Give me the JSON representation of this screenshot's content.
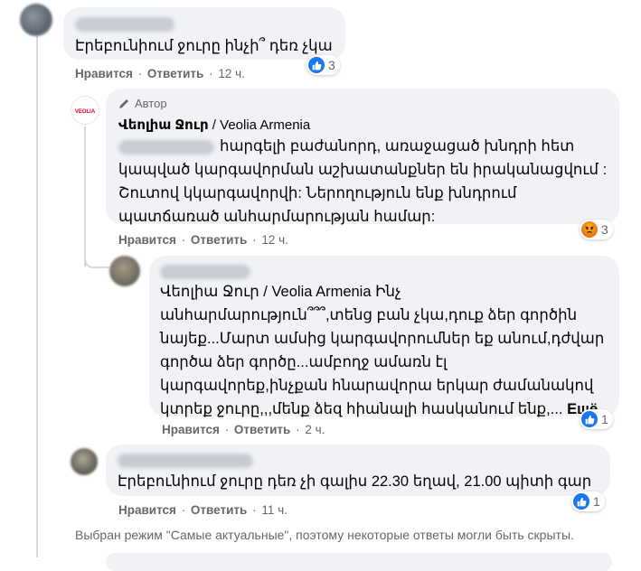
{
  "comments": [
    {
      "text": "Էրեբունիում ջուրը ինչի՞ դեռ չկա",
      "actions": {
        "like": "Нравится",
        "reply": "Ответить",
        "time": "12 ч."
      },
      "reaction_count": "3"
    },
    {
      "badge": "Автор",
      "author": "Վեոլիա Ջուր",
      "author_page": " / Veolia Armenia",
      "lines": [
        "հարգելի բաժանորդ, առաջացած խնդրի հետ",
        "կապված կարգավորման աշխատանքներ են իրականացվում :",
        "Շուտով կկարգավորվի: Ներողություն ենք խնդրում",
        "պատճառած անհարմարության համար:"
      ],
      "actions": {
        "like": "Нравится",
        "reply": "Ответить",
        "time": "12 ч."
      },
      "reaction_count": "3"
    },
    {
      "mention": "Վեոլիա Ջուր / Veolia Armenia",
      "lines": [
        " Ինչ",
        "անհարմարություն՞՞՞,տենց բան չկա,դուք ձեր գործին",
        "նայեք...Մարտ ամսից կարգավորումներ եք անում,դժվար",
        "գործա ձեր գործը...ամբողջ ամառն էլ",
        "կարգավորեք,ինչքան հնարավորա երկար ժամանակով",
        "կտրեք ջուրը,,,մենք ձեզ հիանալի հասկանում ենք,... "
      ],
      "see_more": "Ещё",
      "actions": {
        "like": "Нравится",
        "reply": "Ответить",
        "time": "2 ч."
      },
      "reaction_count": "1"
    },
    {
      "text": "Էրեբունիում ջուրը դեռ չի գալիս 22.30 եղավ, 21.00 պիտի գար",
      "actions": {
        "like": "Нравится",
        "reply": "Ответить",
        "time": "11 ч."
      },
      "reaction_count": "1"
    }
  ],
  "logo_text": "VEOLIA",
  "footer_note": "Выбран режим \"Самые актуальные\", поэтому некоторые ответы могли быть скрыты.",
  "colors": {
    "bubble": "#f0f2f5",
    "like_blue": "#1877f2",
    "meta_gray": "#65676b",
    "veolia_red": "#e2001a"
  }
}
